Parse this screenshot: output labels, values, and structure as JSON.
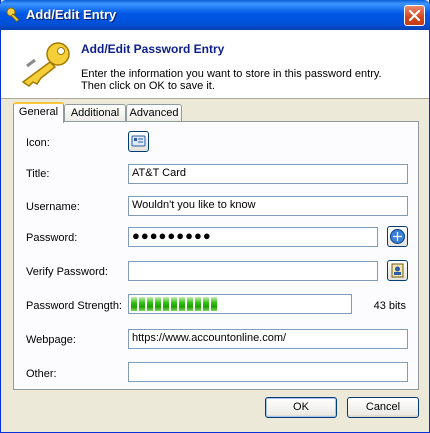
{
  "window": {
    "title": "Add/Edit Entry"
  },
  "header": {
    "heading": "Add/Edit Password Entry",
    "description_line1": "Enter the information you want to store in this password entry.",
    "description_line2": "Then click on OK to save it."
  },
  "tabs": [
    {
      "label": "General",
      "active": true
    },
    {
      "label": "Additional",
      "active": false
    },
    {
      "label": "Advanced",
      "active": false
    }
  ],
  "form": {
    "icon_label": "Icon:",
    "title_label": "Title:",
    "title_value": "AT&T Card",
    "username_label": "Username:",
    "username_value": "Wouldn't you like to know",
    "password_label": "Password:",
    "password_value": "●●●●●●●●●",
    "verify_label": "Verify Password:",
    "verify_value": "",
    "strength_label": "Password Strength:",
    "strength_bits": "43 bits",
    "strength_segments_filled": 11,
    "webpage_label": "Webpage:",
    "webpage_value": "https://www.accountonline.com/",
    "other_label": "Other:",
    "other_value": ""
  },
  "buttons": {
    "ok": "OK",
    "cancel": "Cancel"
  },
  "colors": {
    "title_bar": "#0058e6",
    "heading": "#0c1f8c",
    "strength_bar": "#38c01a",
    "close_button": "#d4441c"
  },
  "icons": [
    "app-icon",
    "close-icon",
    "key-icon",
    "entry-icon",
    "generate-password-icon",
    "verify-password-icon"
  ]
}
